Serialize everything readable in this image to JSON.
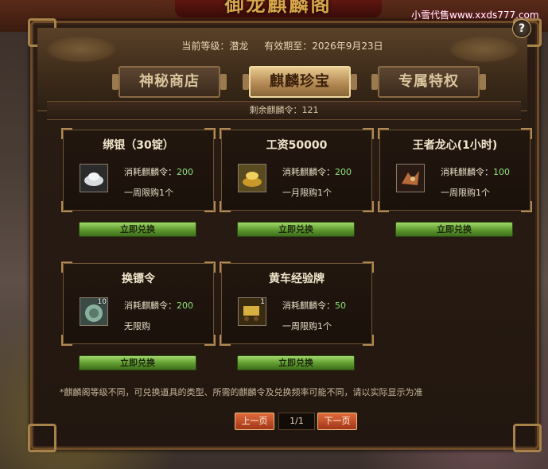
{
  "window": {
    "banner_title": "御龙麒麟阁",
    "watermark": "小雪代售www.xxds777.com",
    "help": "?"
  },
  "status": {
    "level": "当前等级：潜龙",
    "expiry": "有效期至：2026年9月23日"
  },
  "tabs": [
    {
      "label": "神秘商店",
      "active": false
    },
    {
      "label": "麒麟珍宝",
      "active": true
    },
    {
      "label": "专属特权",
      "active": false
    }
  ],
  "remaining": "剩余麒麟令：121",
  "items": [
    {
      "title": "绑银（30锭）",
      "cost_label": "消耗麒麟令：",
      "cost": "200",
      "limit": "一周限购1个",
      "qty": "",
      "icon": "silver-ingot-icon",
      "button": "立即兑换"
    },
    {
      "title": "工资50000",
      "cost_label": "消耗麒麟令：",
      "cost": "200",
      "limit": "一月限购1个",
      "qty": "",
      "icon": "gold-coins-icon",
      "button": "立即兑换"
    },
    {
      "title": "王者龙心(1小时)",
      "cost_label": "消耗麒麟令：",
      "cost": "100",
      "limit": "一周限购1个",
      "qty": "",
      "icon": "dragon-heart-icon",
      "button": "立即兑换"
    },
    {
      "title": "换镖令",
      "cost_label": "消耗麒麟令：",
      "cost": "200",
      "limit": "无限购",
      "qty": "10",
      "icon": "escort-token-icon",
      "button": "立即兑换"
    },
    {
      "title": "黄车经验牌",
      "cost_label": "消耗麒麟令：",
      "cost": "50",
      "limit": "一周限购1个",
      "qty": "1",
      "icon": "cart-exp-card-icon",
      "button": "立即兑换"
    }
  ],
  "note": "*麒麟阁等级不同，可兑换道具的类型、所需的麒麟令及兑换频率可能不同，请以实际显示为准",
  "pager": {
    "prev": "上一页",
    "page": "1/1",
    "next": "下一页"
  },
  "colors": {
    "accent_gold": "#d9a64a",
    "cost_green": "#8fe07a",
    "button_green": "#5e9a2e",
    "pager_orange": "#c04a22"
  }
}
